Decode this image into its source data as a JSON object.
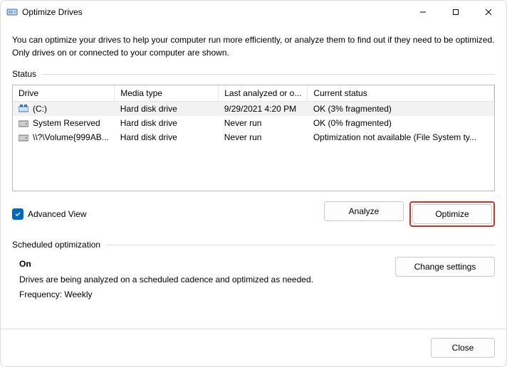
{
  "window": {
    "title": "Optimize Drives"
  },
  "intro": "You can optimize your drives to help your computer run more efficiently, or analyze them to find out if they need to be optimized. Only drives on or connected to your computer are shown.",
  "status_label": "Status",
  "columns": {
    "drive": "Drive",
    "media": "Media type",
    "last": "Last analyzed or o...",
    "status": "Current status"
  },
  "drives": [
    {
      "name": "(C:)",
      "media": "Hard disk drive",
      "last": "9/29/2021 4:20 PM",
      "status": "OK (3% fragmented)"
    },
    {
      "name": "System Reserved",
      "media": "Hard disk drive",
      "last": "Never run",
      "status": "OK (0% fragmented)"
    },
    {
      "name": "\\\\?\\Volume{999AB...",
      "media": "Hard disk drive",
      "last": "Never run",
      "status": "Optimization not available (File System ty..."
    }
  ],
  "advanced_view_label": "Advanced View",
  "buttons": {
    "analyze": "Analyze",
    "optimize": "Optimize",
    "change_settings": "Change settings",
    "close": "Close"
  },
  "sched": {
    "section": "Scheduled optimization",
    "state": "On",
    "desc": "Drives are being analyzed on a scheduled cadence and optimized as needed.",
    "freq": "Frequency: Weekly"
  }
}
